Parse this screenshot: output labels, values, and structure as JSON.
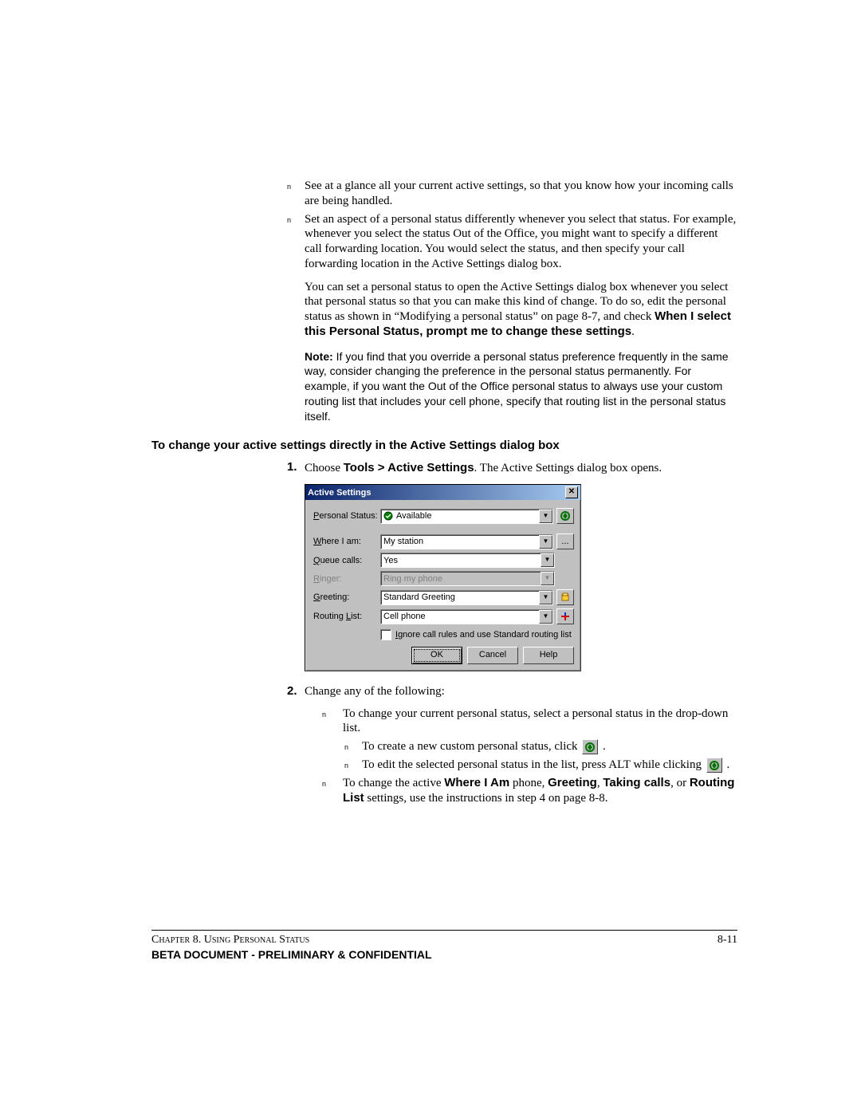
{
  "bullets_top": [
    "See at a glance all your current active settings, so that you know how your incoming calls are being handled.",
    "Set an aspect of a personal status differently whenever you select that status. For example, whenever you select the status Out of the Office, you might want to specify a different call forwarding location. You would select the status, and then specify your call forwarding location in the Active Settings dialog box."
  ],
  "para_followup": "You can set a personal status to open the Active Settings dialog box whenever you select that personal status so that you can make this kind of change. To do so, edit the personal status as shown in “Modifying a personal status” on page 8-7, and check ",
  "para_followup_bold": "When I select this Personal Status, prompt me to change these settings",
  "note_label": "Note:",
  "note_text": "If you find that you override a personal status preference frequently in the same way, consider changing the preference in the personal status permanently. For example, if you want the Out of the Office personal status to always use your custom routing list that includes your cell phone, specify that routing list in the personal status itself.",
  "heading": "To change your active settings directly in the Active Settings dialog box",
  "step1_pre": "Choose ",
  "step1_bold": "Tools > Active Settings",
  "step1_post": ". The Active Settings dialog box opens.",
  "step2": "Change any of the following:",
  "sub1": "To change your current personal status, select a personal status in the drop-down list.",
  "subsub1": "To create a new custom personal status, click ",
  "subsub2": "To edit the selected personal status in the list, press ALT while clicking ",
  "sub2_pre": "To change the active ",
  "sub2_b1": "Where I Am",
  "sub2_mid1": " phone, ",
  "sub2_b2": "Greeting",
  "sub2_mid2": ", ",
  "sub2_b3": "Taking calls",
  "sub2_mid3": ", or ",
  "sub2_b4": "Routing List",
  "sub2_post": " settings, use the instructions in step 4 on page 8-8.",
  "dialog": {
    "title": "Active Settings",
    "labels": {
      "personal_status": "Personal Status:",
      "where": "Where I am:",
      "queue": "Queue calls:",
      "ringer": "Ringer:",
      "greeting": "Greeting:",
      "routing": "Routing List:"
    },
    "values": {
      "personal_status": "Available",
      "where": "My station",
      "queue": "Yes",
      "ringer": "Ring my phone",
      "greeting": "Standard Greeting",
      "routing": "Cell phone"
    },
    "checkbox": "Ignore call rules and use Standard routing list",
    "buttons": {
      "ok": "OK",
      "cancel": "Cancel",
      "help": "Help"
    },
    "ellipsis": "..."
  },
  "footer": {
    "chapter": "Chapter 8. Using Personal Status",
    "page": "8-11",
    "confidential": "BETA DOCUMENT - PRELIMINARY & CONFIDENTIAL"
  },
  "marks": {
    "n": "n",
    "period": "."
  }
}
